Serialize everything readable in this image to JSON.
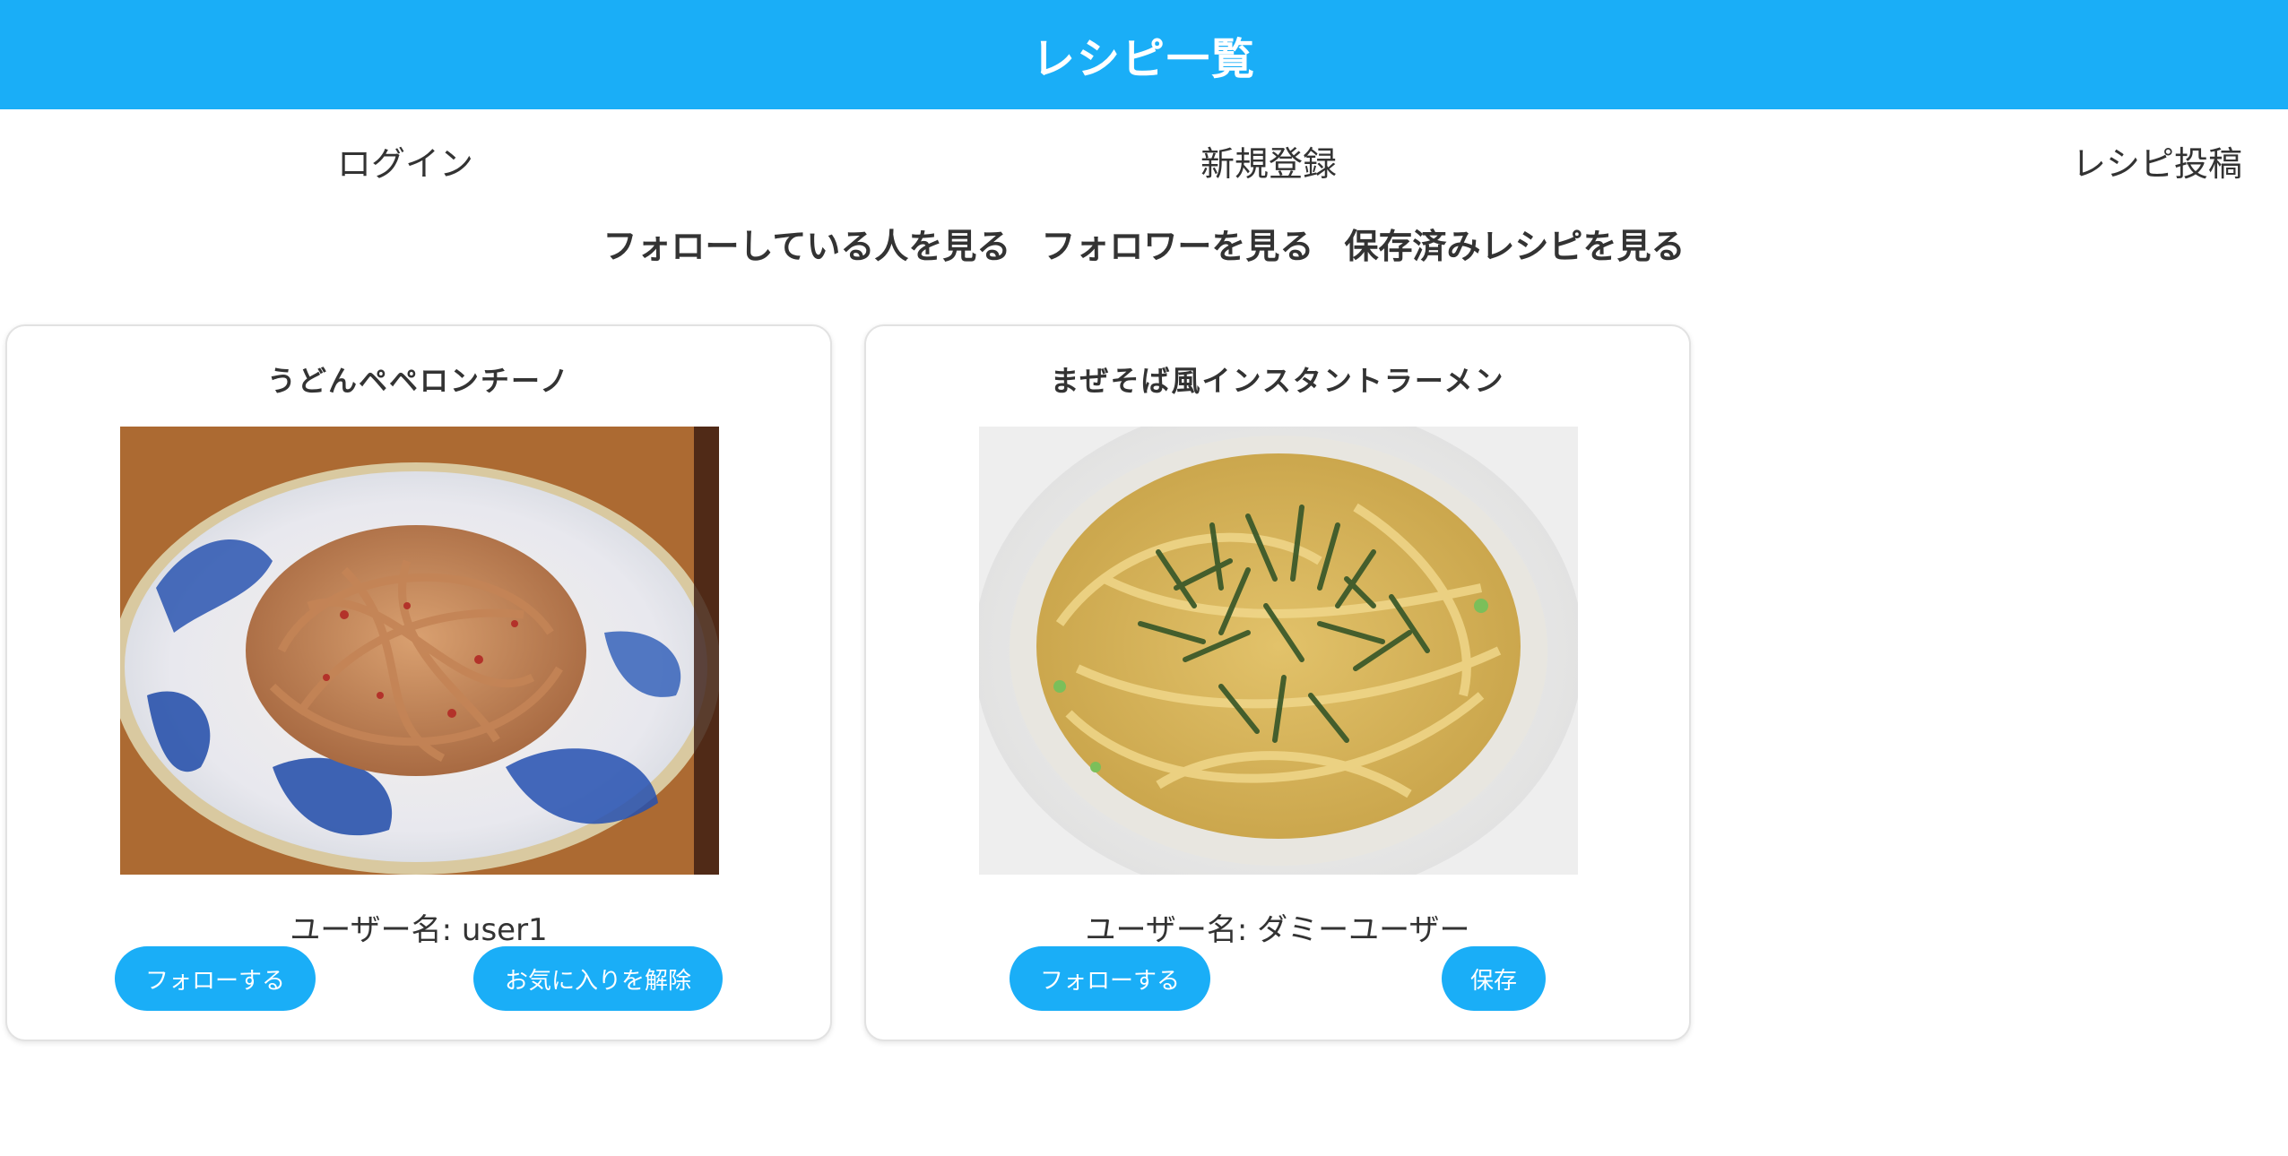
{
  "header": {
    "title": "レシピ一覧"
  },
  "nav": {
    "login": "ログイン",
    "signup": "新規登録",
    "post_recipe": "レシピ投稿"
  },
  "sub_nav": {
    "following": "フォローしている人を見る",
    "followers": "フォロワーを見る",
    "saved": "保存済みレシピを見る"
  },
  "recipes": [
    {
      "title": "うどんペペロンチーノ",
      "username": "ユーザー名: user1",
      "follow_label": "フォローする",
      "action_label": "お気に入りを解除"
    },
    {
      "title": "まぜそば風インスタントラーメン",
      "username": "ユーザー名: ダミーユーザー",
      "follow_label": "フォローする",
      "action_label": "保存"
    }
  ],
  "colors": {
    "accent": "#1aaef7",
    "text": "#333333"
  }
}
